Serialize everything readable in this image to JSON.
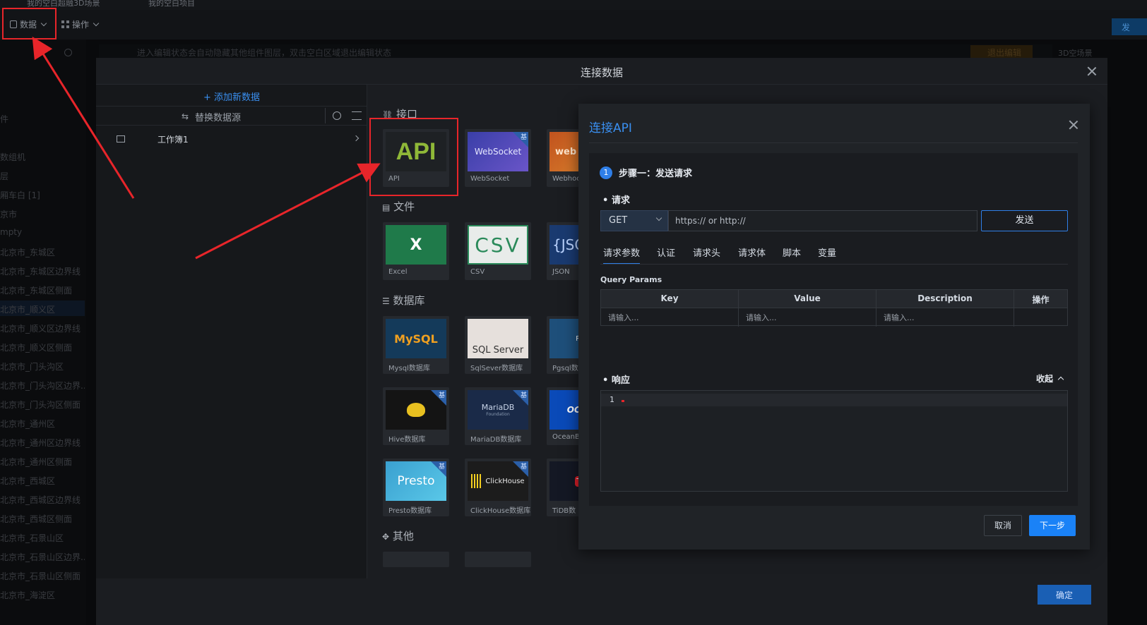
{
  "top_tabs": [
    "我的空白超融3D场景",
    "我的空白项目"
  ],
  "toolbar": {
    "data_label": "数据",
    "ops_label": "操作",
    "publish_label": "发"
  },
  "notice": {
    "text": "进入编辑状态会自动隐藏其他组件图层，双击空白区域退出编辑状态",
    "exit_label": "退出编辑",
    "scene_label": "3D空场景"
  },
  "left_tree": [
    "件",
    "",
    "数组机",
    "层",
    "厢车白 [1]",
    "京市",
    "mpty",
    "北京市_东城区",
    "北京市_东城区边界线",
    "北京市_东城区侧面",
    "北京市_顺义区",
    "北京市_顺义区边界线",
    "北京市_顺义区侧面",
    "北京市_门头沟区",
    "北京市_门头沟区边界...",
    "北京市_门头沟区侧面",
    "北京市_通州区",
    "北京市_通州区边界线",
    "北京市_通州区侧面",
    "北京市_西城区",
    "北京市_西城区边界线",
    "北京市_西城区侧面",
    "北京市_石景山区",
    "北京市_石景山区边界...",
    "北京市_石景山区侧面",
    "北京市_海淀区"
  ],
  "modal": {
    "title": "连接数据",
    "add_data": "+ 添加新数据",
    "replace_source": "替换数据源",
    "sheet": "工作簿1",
    "confirm": "确定"
  },
  "sections": {
    "interface": "接口",
    "file": "文件",
    "database": "数据库",
    "other": "其他"
  },
  "badge": "基",
  "cards": {
    "api": {
      "thumb": "API",
      "label": "API"
    },
    "websocket": {
      "thumb": "WebSocket",
      "label": "WebSocket"
    },
    "webhook": {
      "thumb": "web",
      "label": "Webhook"
    },
    "excel": {
      "thumb": "X",
      "label": "Excel"
    },
    "csv": {
      "thumb": "CSV",
      "label": "CSV"
    },
    "json": {
      "thumb": "{JSO",
      "label": "JSON"
    },
    "mysql": {
      "thumb": "MySQL",
      "label": "Mysql数据库"
    },
    "sqlserver": {
      "thumb": "SQL Server",
      "label": "SqlSever数据库"
    },
    "pgsql": {
      "thumb": "Po",
      "label": "Pgsql数"
    },
    "hive": {
      "thumb": "",
      "label": "Hive数据库"
    },
    "mariadb": {
      "thumb": "MariaDB",
      "thumb_sub": "Foundation",
      "label": "MariaDB数据库"
    },
    "ocean": {
      "thumb": "OCEA",
      "label": "OceanB"
    },
    "presto": {
      "thumb": "Presto",
      "label": "Presto数据库"
    },
    "clickhouse": {
      "thumb": "ClickHouse",
      "label": "ClickHouse数据库"
    },
    "tidb": {
      "thumb": "Ti",
      "label": "TiDB数"
    }
  },
  "api_dialog": {
    "title": "连接API",
    "step_num": "1",
    "step_title": "步骤一：发送请求",
    "request_label": "请求",
    "method": "GET",
    "url_placeholder": "https:// or http://",
    "send": "发送",
    "tabs": [
      "请求参数",
      "认证",
      "请求头",
      "请求体",
      "脚本",
      "变量"
    ],
    "query_params": "Query Params",
    "columns": [
      "Key",
      "Value",
      "Description",
      "操作"
    ],
    "row_placeholders": [
      "请输入...",
      "请输入...",
      "请输入..."
    ],
    "response_label": "响应",
    "collapse": "收起",
    "line_no": "1",
    "cancel": "取消",
    "next": "下一步"
  },
  "colors": {
    "accent": "#1a82f7",
    "annotation": "#e8252a"
  }
}
